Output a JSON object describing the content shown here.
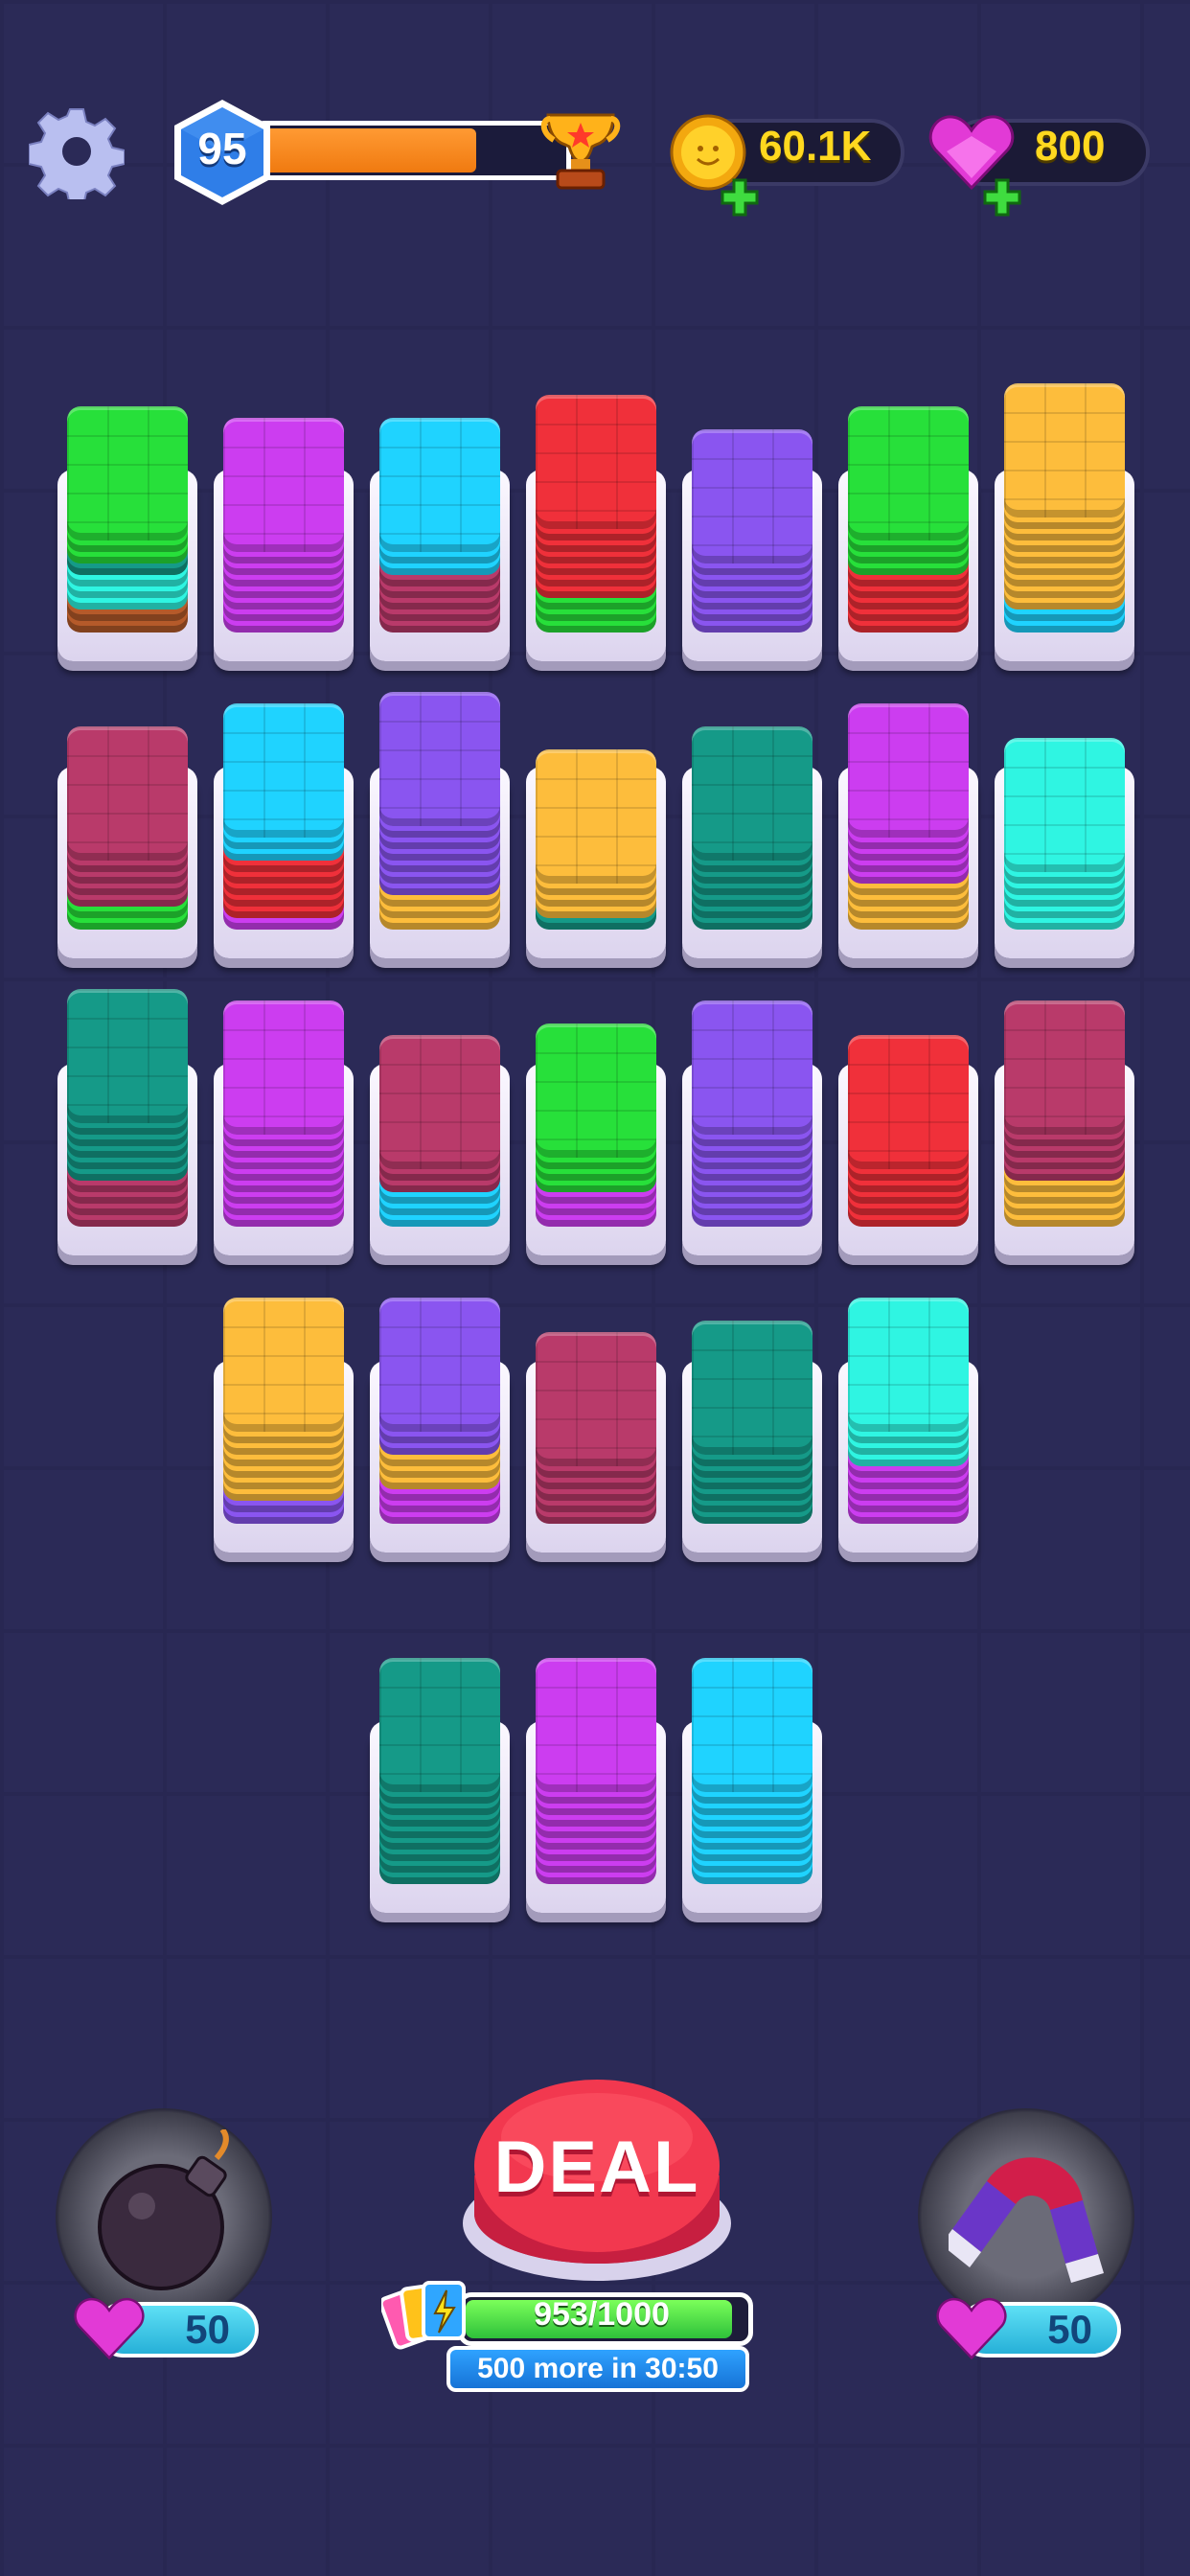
{
  "header": {
    "level": "95",
    "xp_progress": 0.72,
    "coins": "60.1K",
    "gems": "800"
  },
  "colors": {
    "green": "#27e03a",
    "red": "#f0303a",
    "cyan": "#1fd3ff",
    "teal": "#159a88",
    "mint": "#2ff5e2",
    "purple": "#8a55f0",
    "magenta": "#cc3df0",
    "maroon": "#b93a6a",
    "yellow": "#fdbd3c",
    "brown": "#b55a2a"
  },
  "board": [
    {
      "stack": [
        "brown",
        "brown",
        "mint",
        "mint",
        "mint",
        "teal",
        "green",
        "green"
      ],
      "top": "green"
    },
    {
      "stack": [
        "magenta",
        "magenta",
        "magenta",
        "magenta",
        "magenta",
        "magenta",
        "magenta"
      ],
      "top": "magenta"
    },
    {
      "stack": [
        "maroon",
        "maroon",
        "maroon",
        "maroon",
        "maroon",
        "cyan",
        "cyan"
      ],
      "top": "cyan"
    },
    {
      "stack": [
        "green",
        "green",
        "green",
        "red",
        "red",
        "red",
        "red",
        "red",
        "red"
      ],
      "top": "red"
    },
    {
      "stack": [
        "purple",
        "purple",
        "purple",
        "purple",
        "purple",
        "purple"
      ],
      "top": "purple"
    },
    {
      "stack": [
        "red",
        "red",
        "red",
        "red",
        "red",
        "green",
        "green",
        "green"
      ],
      "top": "green"
    },
    {
      "stack": [
        "cyan",
        "cyan",
        "yellow",
        "yellow",
        "yellow",
        "yellow",
        "yellow",
        "yellow",
        "yellow",
        "yellow"
      ],
      "top": "yellow"
    },
    {
      "stack": [
        "green",
        "green",
        "maroon",
        "maroon",
        "maroon",
        "maroon"
      ],
      "top": "maroon"
    },
    {
      "stack": [
        "magenta",
        "red",
        "red",
        "red",
        "red",
        "red",
        "cyan",
        "cyan"
      ],
      "top": "cyan"
    },
    {
      "stack": [
        "yellow",
        "yellow",
        "yellow",
        "purple",
        "purple",
        "purple",
        "purple",
        "purple",
        "purple"
      ],
      "top": "purple"
    },
    {
      "stack": [
        "teal",
        "yellow",
        "yellow",
        "yellow"
      ],
      "top": "yellow"
    },
    {
      "stack": [
        "teal",
        "teal",
        "teal",
        "teal",
        "teal",
        "teal"
      ],
      "top": "teal"
    },
    {
      "stack": [
        "yellow",
        "yellow",
        "yellow",
        "yellow",
        "magenta",
        "magenta",
        "magenta",
        "magenta"
      ],
      "top": "magenta"
    },
    {
      "stack": [
        "mint",
        "mint",
        "mint",
        "mint",
        "mint"
      ],
      "top": "mint"
    },
    {
      "stack": [
        "maroon",
        "maroon",
        "maroon",
        "maroon",
        "teal",
        "teal",
        "teal",
        "teal",
        "teal"
      ],
      "top": "teal"
    },
    {
      "stack": [
        "magenta",
        "magenta",
        "magenta",
        "magenta",
        "magenta",
        "magenta",
        "magenta",
        "magenta"
      ],
      "top": "magenta"
    },
    {
      "stack": [
        "cyan",
        "cyan",
        "cyan",
        "maroon",
        "maroon"
      ],
      "top": "maroon"
    },
    {
      "stack": [
        "magenta",
        "magenta",
        "magenta",
        "green",
        "green",
        "green"
      ],
      "top": "green"
    },
    {
      "stack": [
        "purple",
        "purple",
        "purple",
        "purple",
        "purple",
        "purple",
        "purple",
        "purple"
      ],
      "top": "purple"
    },
    {
      "stack": [
        "red",
        "red",
        "red",
        "red",
        "red"
      ],
      "top": "red"
    },
    {
      "stack": [
        "yellow",
        "yellow",
        "yellow",
        "yellow",
        "maroon",
        "maroon",
        "maroon",
        "maroon"
      ],
      "top": "maroon"
    },
    {
      "stack": [
        "purple",
        "purple",
        "yellow",
        "yellow",
        "yellow",
        "yellow",
        "yellow",
        "yellow"
      ],
      "top": "yellow"
    },
    {
      "stack": [
        "magenta",
        "magenta",
        "magenta",
        "yellow",
        "yellow",
        "yellow",
        "purple",
        "purple"
      ],
      "top": "purple"
    },
    {
      "stack": [
        "maroon",
        "maroon",
        "maroon",
        "maroon",
        "maroon"
      ],
      "top": "maroon"
    },
    {
      "stack": [
        "teal",
        "teal",
        "teal",
        "teal",
        "teal",
        "teal"
      ],
      "top": "teal"
    },
    {
      "stack": [
        "magenta",
        "magenta",
        "magenta",
        "magenta",
        "magenta",
        "mint",
        "mint",
        "mint"
      ],
      "top": "mint"
    },
    {
      "stack": [
        "teal",
        "teal",
        "teal",
        "teal",
        "teal",
        "teal",
        "teal",
        "teal"
      ],
      "top": "teal"
    },
    {
      "stack": [
        "magenta",
        "magenta",
        "magenta",
        "magenta",
        "magenta",
        "magenta",
        "magenta",
        "magenta"
      ],
      "top": "magenta"
    },
    {
      "stack": [
        "cyan",
        "cyan",
        "cyan",
        "cyan",
        "cyan",
        "cyan",
        "cyan",
        "cyan"
      ],
      "top": "cyan"
    }
  ],
  "powerups": {
    "bomb": {
      "icon": "bomb-icon",
      "cost": "50"
    },
    "magnet": {
      "icon": "magnet-icon",
      "cost": "50"
    }
  },
  "deal": {
    "label": "DEAL",
    "count_text": "953/1000",
    "progress": 0.953,
    "timer_text": "500 more in 30:50"
  }
}
